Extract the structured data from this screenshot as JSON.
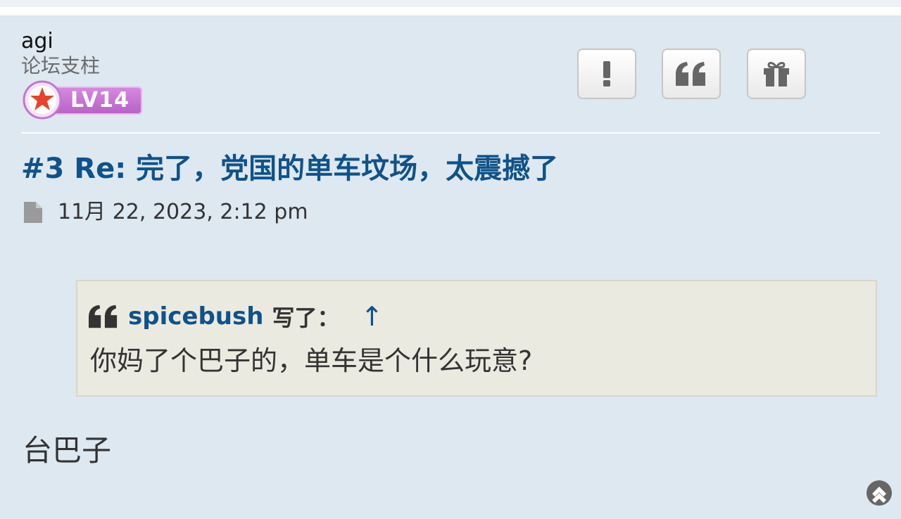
{
  "post": {
    "author": "agi",
    "rank": "论坛支柱",
    "level": "LV14",
    "title": "#3 Re: 完了，党国的单车坟场，太震撼了",
    "date": "11月 22, 2023, 2:12 pm",
    "quote": {
      "author": "spicebush",
      "wrote": "写了：",
      "jump": "↑",
      "text": "你妈了个巴子的，单车是个什么玩意?"
    },
    "body": "台巴子"
  },
  "icons": {
    "level_badge": "star-badge-icon",
    "report": "exclamation-icon",
    "quote": "quote-icon",
    "gift": "gift-icon",
    "post_link": "document-icon",
    "quote_mark": "quote-mark-icon",
    "back_to_top": "chevron-up-circle-icon"
  },
  "colors": {
    "background": "#dde8f1",
    "link": "#105289",
    "quote_background": "#ebeae0",
    "level_badge": "#c77ad3"
  }
}
